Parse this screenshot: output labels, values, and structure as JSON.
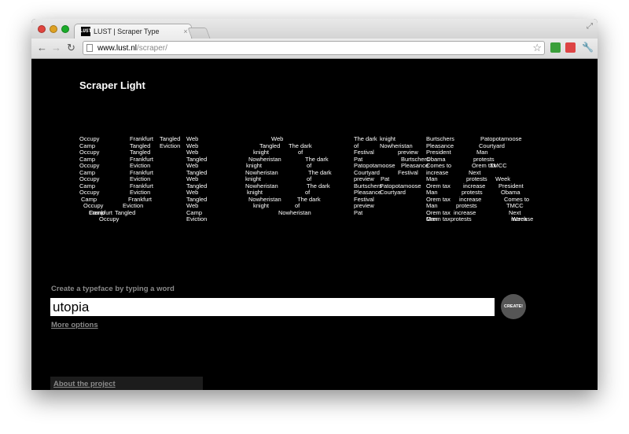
{
  "browser": {
    "tab_title": "LUST | Scraper Type",
    "favicon_text": "LUST",
    "tab_close": "×",
    "url_host": "www.lust.nl",
    "url_path": "/scraper/"
  },
  "page": {
    "heading": "Scraper Light",
    "prompt": "Create a typeface by typing a word",
    "input_value": "utopia",
    "create_button": "CREATE!",
    "more_options": "More options",
    "about_link": "About the project"
  },
  "glyph_words": [
    "Occupy",
    "Camp",
    "Occupy",
    "Camp",
    "Occupy",
    "Camp",
    "Occupy",
    "Camp",
    "Occupy",
    "Camp",
    "Occupy",
    "Camp",
    "Occupy",
    "Frankfurt",
    "Tangled",
    "Web",
    "Tangled",
    "Eviction",
    "Web",
    "Tangled",
    "Web",
    "Frankfurt",
    "Tangled",
    "Eviction",
    "Web",
    "Frankfurt",
    "Tangled",
    "Eviction",
    "Web",
    "Frankfurt",
    "Tangled",
    "Eviction",
    "Web",
    "Frankfurt",
    "Tangled",
    "Eviction",
    "Web",
    "Frankfurt",
    "Tangled",
    "Camp",
    "Eviction",
    "Web",
    "Tangled",
    "The dark",
    "knight",
    "of",
    "Nowheristan",
    "The dark",
    "knight",
    "of",
    "Nowheristan",
    "The dark",
    "knight",
    "of",
    "Nowheristan",
    "The dark",
    "knight",
    "of",
    "Nowheristan",
    "The dark",
    "knight",
    "of",
    "Nowheristan",
    "The dark",
    "knight",
    "of",
    "Nowheristan",
    "Festival",
    "preview",
    "Pat",
    "Burtschers",
    "Patopotamoose",
    "Pleasance",
    "Courtyard",
    "Festival",
    "preview",
    "Pat",
    "Burtschers",
    "Patopotamoose",
    "Pleasance",
    "Courtyard",
    "Festival",
    "preview",
    "Pat",
    "Burtschers",
    "Patopotamoose",
    "Pleasance",
    "Courtyard",
    "President",
    "Man",
    "Obama",
    "protests",
    "Comes to",
    "Orem tax",
    "TMCC",
    "increase",
    "Next",
    "Man",
    "protests",
    "Week",
    "Orem tax",
    "increase",
    "President",
    "Man",
    "protests",
    "Obama",
    "Orem tax",
    "increase",
    "Comes to",
    "Man",
    "protests",
    "TMCC",
    "Orem tax",
    "increase",
    "Next",
    "Man",
    "protests",
    "Week",
    "Orem tax",
    "increase",
    "President",
    "Man",
    "protests"
  ],
  "colors": {
    "background": "#000000",
    "text": "#ffffff",
    "muted": "#8a8a8a",
    "create_button": "#555555"
  }
}
